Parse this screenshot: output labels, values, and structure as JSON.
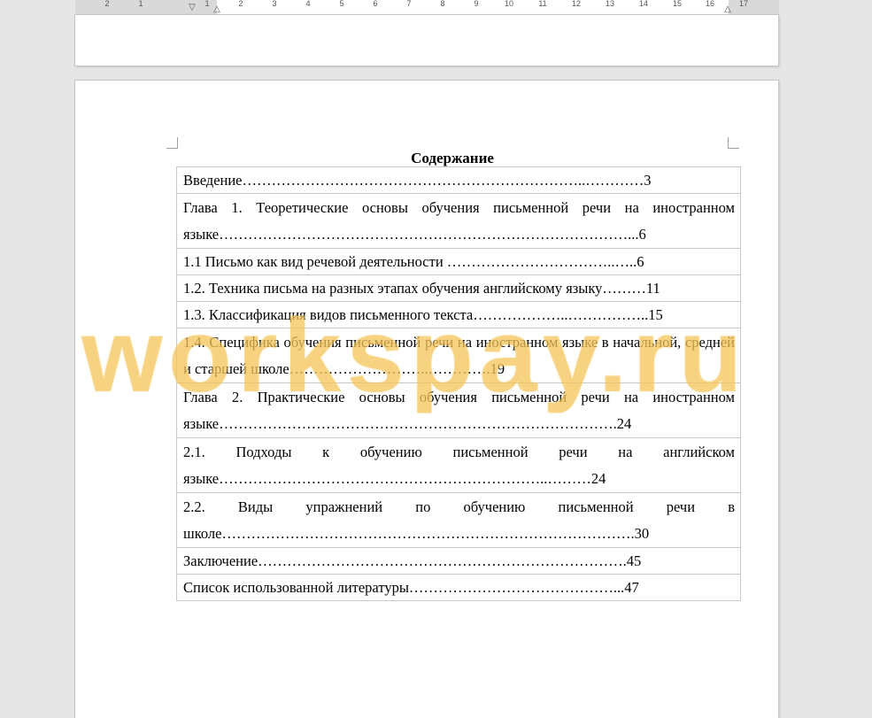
{
  "ruler": {
    "numbers": [
      "2",
      "1",
      "1",
      "2",
      "3",
      "4",
      "5",
      "6",
      "7",
      "8",
      "9",
      "10",
      "11",
      "12",
      "13",
      "14",
      "15",
      "16",
      "17"
    ]
  },
  "document": {
    "title": "Содержание",
    "toc": [
      {
        "text": "Введение……………………………………………………………..…………3"
      },
      {
        "text": "Глава 1. Теоретические основы обучения письменной речи на иностранном языке…………………………………………………………………………...6"
      },
      {
        "text": "1.1 Письмо как вид речевой деятельности ……………………………..…..6"
      },
      {
        "text": "1.2. Техника письма на разных этапах обучения английскому языку………11"
      },
      {
        "text": "1.3. Классификация видов письменного текста………………..……………..15"
      },
      {
        "text": "1.4. Специфика обучения письменной речи на иностранном языке в начальной, средней и старшей школе………………………..………….19"
      },
      {
        "text": "Глава 2. Практические основы обучения письменной речи на иностранном языке……………………………………………………………………….24"
      },
      {
        "text": "2.1. Подходы к обучению письменной речи на английском языке…………………………………………………………..………24"
      },
      {
        "text": "2.2. Виды упражнений по обучению письменной речи в школе………………………………………………………………………….30"
      },
      {
        "text": "Заключение………………………………………………………………….45"
      },
      {
        "text": "Список использованной литературы……………………………………...47"
      }
    ]
  },
  "watermark": {
    "text": "workspay.ru",
    "color": "#ecaa28"
  }
}
